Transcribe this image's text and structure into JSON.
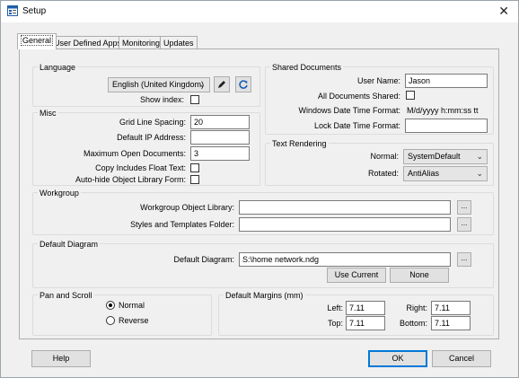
{
  "window": {
    "title": "Setup",
    "close_glyph": "✕"
  },
  "tabs": [
    {
      "label": "General",
      "active": true
    },
    {
      "label": "User Defined Apps"
    },
    {
      "label": "Monitoring"
    },
    {
      "label": "Updates"
    }
  ],
  "language": {
    "group_label": "Language",
    "selected": "English (United Kingdom)",
    "show_index_label": "Show index:",
    "edit_icon": "pencil-icon",
    "refresh_icon": "refresh-icon"
  },
  "misc": {
    "group_label": "Misc",
    "grid_line_spacing_label": "Grid Line Spacing:",
    "grid_line_spacing_value": "20",
    "default_ip_label": "Default IP Address:",
    "default_ip_value": "",
    "max_open_docs_label": "Maximum Open Documents:",
    "max_open_docs_value": "3",
    "copy_float_label": "Copy Includes Float Text:",
    "autohide_label": "Auto-hide Object Library Form:"
  },
  "shared_documents": {
    "group_label": "Shared Documents",
    "user_name_label": "User Name:",
    "user_name_value": "Jason",
    "all_shared_label": "All Documents Shared:",
    "win_datetime_label": "Windows Date Time Format:",
    "win_datetime_value": "M/d/yyyy h:mm:ss tt",
    "lock_datetime_label": "Lock Date Time Format:",
    "lock_datetime_value": ""
  },
  "text_rendering": {
    "group_label": "Text Rendering",
    "normal_label": "Normal:",
    "normal_value": "SystemDefault",
    "rotated_label": "Rotated:",
    "rotated_value": "AntiAlias"
  },
  "workgroup": {
    "group_label": "Workgroup",
    "library_label": "Workgroup Object Library:",
    "library_value": "",
    "styles_label": "Styles and Templates Folder:",
    "styles_value": "",
    "browse_label": "..."
  },
  "default_diagram": {
    "group_label": "Default Diagram",
    "diagram_label": "Default Diagram:",
    "diagram_value": "S:\\home network.ndg",
    "browse_label": "...",
    "use_current_label": "Use Current",
    "none_label": "None"
  },
  "pan_scroll": {
    "group_label": "Pan and Scroll",
    "normal_label": "Normal",
    "reverse_label": "Reverse",
    "selected": "Normal"
  },
  "margins": {
    "group_label": "Default Margins (mm)",
    "left_label": "Left:",
    "left_value": "7.11",
    "right_label": "Right:",
    "right_value": "7.11",
    "top_label": "Top:",
    "top_value": "7.11",
    "bottom_label": "Bottom:",
    "bottom_value": "7.11"
  },
  "footer": {
    "help_label": "Help",
    "ok_label": "OK",
    "cancel_label": "Cancel"
  }
}
